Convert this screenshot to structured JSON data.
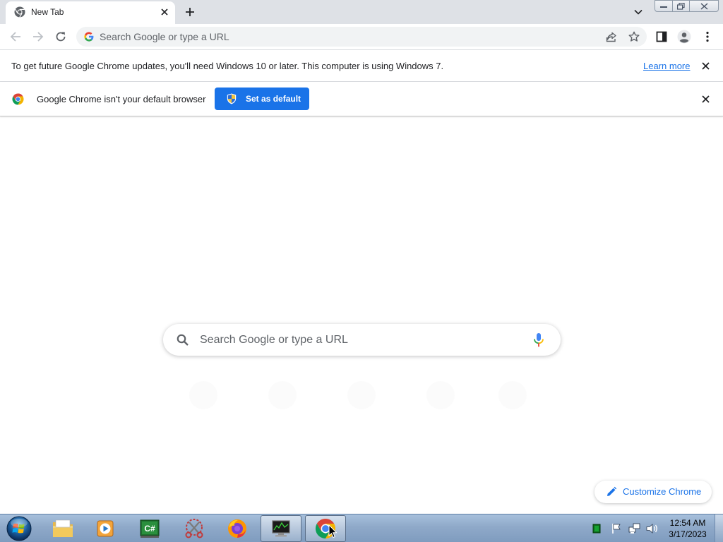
{
  "browser": {
    "tab": {
      "title": "New Tab",
      "favicon": "chrome-icon"
    },
    "window_controls": [
      "minimize-icon",
      "maximize-icon",
      "close-icon"
    ]
  },
  "omnibox": {
    "placeholder": "Search Google or type a URL"
  },
  "infobars": {
    "update": {
      "message": "To get future Google Chrome updates, you'll need Windows 10 or later. This computer is using Windows 7.",
      "link": "Learn more"
    },
    "default_browser": {
      "message": "Google Chrome isn't your default browser",
      "button": "Set as default"
    }
  },
  "ntp": {
    "search_placeholder": "Search Google or type a URL",
    "customize_label": "Customize Chrome"
  },
  "taskbar": {
    "apps": [
      "windows-explorer-icon",
      "media-player-icon",
      "csharp-ide-icon",
      "snipping-tool-icon",
      "firefox-icon",
      "system-monitor-icon",
      "chrome-icon"
    ],
    "active_app": "chrome-icon",
    "clock": {
      "time": "12:54 AM",
      "date": "3/17/2023"
    }
  },
  "colors": {
    "accent": "#1a73e8",
    "tabstrip": "#dee1e6",
    "taskbar": "#8fa9c9"
  }
}
